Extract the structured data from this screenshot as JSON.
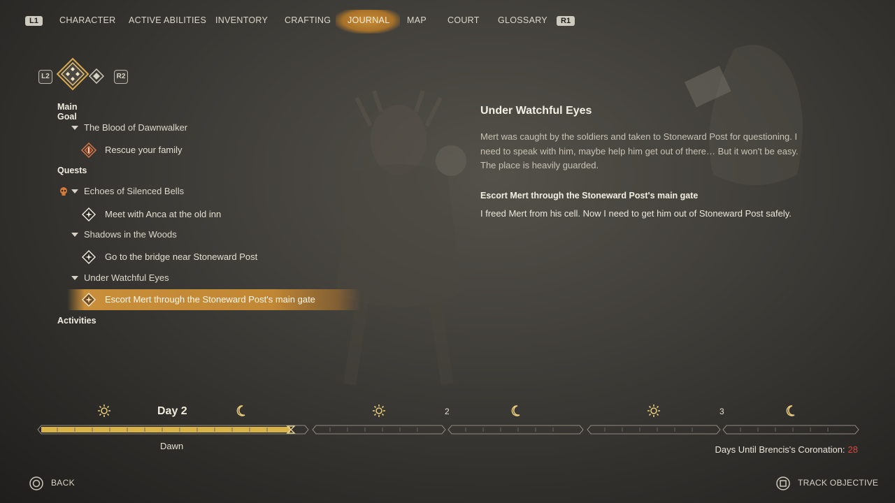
{
  "nav": {
    "left_button": "L1",
    "right_button": "R1",
    "tabs": [
      "CHARACTER",
      "ACTIVE ABILITIES",
      "INVENTORY",
      "CRAFTING",
      "JOURNAL",
      "MAP",
      "COURT",
      "GLOSSARY"
    ],
    "active_tab": "JOURNAL"
  },
  "category_selector": {
    "left_button": "L2",
    "right_button": "R2"
  },
  "list": {
    "main_goal": {
      "heading": "Main Goal",
      "quest": "The Blood of Dawnwalker",
      "objective": "Rescue your family"
    },
    "quests": {
      "heading": "Quests",
      "items": [
        {
          "name": "Echoes of Silenced Bells",
          "objective": "Meet with Anca at the old inn"
        },
        {
          "name": "Shadows in the Woods",
          "objective": "Go to the bridge near Stoneward Post"
        },
        {
          "name": "Under Watchful Eyes",
          "objective": "Escort Mert through the Stoneward Post's main gate"
        }
      ]
    },
    "activities": {
      "heading": "Activities"
    }
  },
  "detail": {
    "title": "Under Watchful Eyes",
    "description": "Mert was caught by the soldiers and taken to Stoneward Post for questioning. I need to speak with him, maybe help him get out of there… But it won't be easy. The place is heavily guarded.",
    "objective_title": "Escort Mert through the Stoneward Post's main gate",
    "objective_text": "I freed Mert from his cell. Now I need to get him out of Stoneward Post safely."
  },
  "timeline": {
    "current_day_label": "Day 2",
    "next_day_1": "2",
    "next_day_2": "3",
    "phase": "Dawn",
    "progress_current_segment": 1.0
  },
  "coronation": {
    "label": "Days Until Brencis's Coronation:",
    "value": "28"
  },
  "prompts": {
    "back": "BACK",
    "track": "TRACK OBJECTIVE"
  },
  "colors": {
    "accent": "#c98e3a",
    "timeline_fill": "#d9b24a",
    "countdown": "#e0453a"
  }
}
